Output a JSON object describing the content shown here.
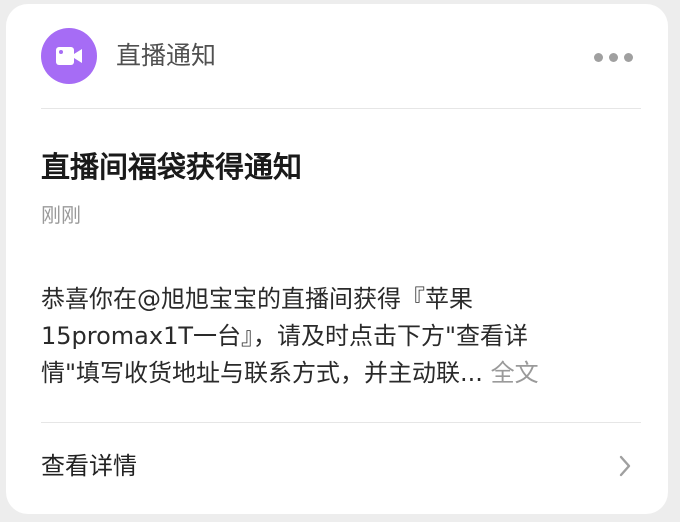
{
  "header": {
    "app_icon": "video-camera-icon",
    "title": "直播通知",
    "more_icon": "more-dots-icon"
  },
  "message": {
    "title": "直播间福袋获得通知",
    "time": "刚刚",
    "body_lines": [
      "恭喜你在@旭旭宝宝的直播间获得『苹果",
      "15promax1T一台』，请及时点击下方\"查看详",
      "情\"填写收货地址与联系方式，并主动联..."
    ],
    "full_text_label": "全文"
  },
  "footer": {
    "details_label": "查看详情",
    "chevron_icon": "chevron-right-icon"
  },
  "colors": {
    "accent": "#a66cf5",
    "card_bg": "#ffffff",
    "page_bg": "#ededed",
    "secondary_text": "#9a9a9a"
  }
}
